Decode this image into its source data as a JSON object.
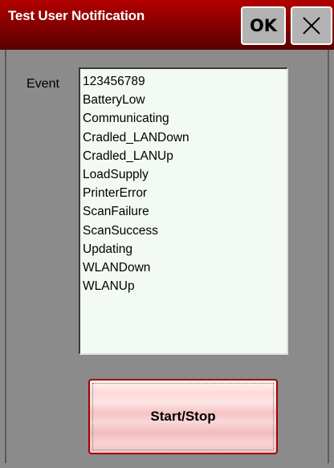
{
  "window": {
    "title": "Test User Notification",
    "ok_label": "OK"
  },
  "form": {
    "event_label": "Event",
    "events": [
      "123456789",
      "BatteryLow",
      "Communicating",
      "Cradled_LANDown",
      "Cradled_LANUp",
      "LoadSupply",
      "PrinterError",
      "ScanFailure",
      "ScanSuccess",
      "Updating",
      "WLANDown",
      "WLANUp"
    ],
    "start_stop_label": "Start/Stop"
  },
  "icons": {
    "close": "close-icon"
  },
  "colors": {
    "titlebar": "#8a0000",
    "background": "#8b8b8b",
    "listbox": "#f3faf3",
    "button_border": "#a40000"
  }
}
